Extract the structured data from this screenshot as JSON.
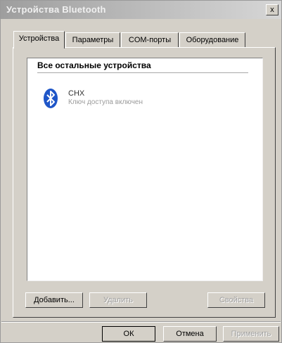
{
  "window": {
    "title": "Устройства Bluetooth",
    "close_label": "x"
  },
  "tabs": [
    {
      "label": "Устройства",
      "active": true
    },
    {
      "label": "Параметры",
      "active": false
    },
    {
      "label": "COM-порты",
      "active": false
    },
    {
      "label": "Оборудование",
      "active": false
    }
  ],
  "device_list": {
    "group_header": "Все остальные устройства",
    "devices": [
      {
        "name": "CHX",
        "status": "Ключ доступа включен",
        "icon": "bluetooth-icon"
      }
    ]
  },
  "panel_buttons": {
    "add": "Добавить...",
    "remove": "Удалить",
    "properties": "Свойства"
  },
  "dialog_buttons": {
    "ok": "ОК",
    "cancel": "Отмена",
    "apply": "Применить"
  },
  "colors": {
    "bluetooth_blue": "#1f56c8",
    "dialog_face": "#d4d0c8"
  }
}
